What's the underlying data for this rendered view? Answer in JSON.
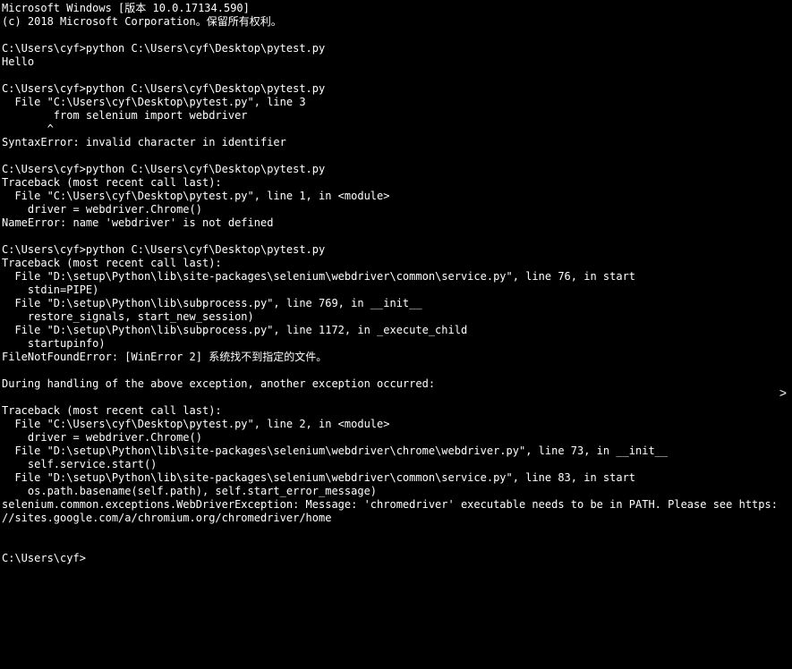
{
  "terminal": {
    "lines": [
      "Microsoft Windows [版本 10.0.17134.590]",
      "(c) 2018 Microsoft Corporation。保留所有权利。",
      "",
      "C:\\Users\\cyf>python C:\\Users\\cyf\\Desktop\\pytest.py",
      "Hello",
      "",
      "C:\\Users\\cyf>python C:\\Users\\cyf\\Desktop\\pytest.py",
      "  File \"C:\\Users\\cyf\\Desktop\\pytest.py\", line 3",
      "        from selenium import webdriver",
      "       ^",
      "SyntaxError: invalid character in identifier",
      "",
      "C:\\Users\\cyf>python C:\\Users\\cyf\\Desktop\\pytest.py",
      "Traceback (most recent call last):",
      "  File \"C:\\Users\\cyf\\Desktop\\pytest.py\", line 1, in <module>",
      "    driver = webdriver.Chrome()",
      "NameError: name 'webdriver' is not defined",
      "",
      "C:\\Users\\cyf>python C:\\Users\\cyf\\Desktop\\pytest.py",
      "Traceback (most recent call last):",
      "  File \"D:\\setup\\Python\\lib\\site-packages\\selenium\\webdriver\\common\\service.py\", line 76, in start",
      "    stdin=PIPE)",
      "  File \"D:\\setup\\Python\\lib\\subprocess.py\", line 769, in __init__",
      "    restore_signals, start_new_session)",
      "  File \"D:\\setup\\Python\\lib\\subprocess.py\", line 1172, in _execute_child",
      "    startupinfo)",
      "FileNotFoundError: [WinError 2] 系统找不到指定的文件。",
      "",
      "During handling of the above exception, another exception occurred:",
      "",
      "Traceback (most recent call last):",
      "  File \"C:\\Users\\cyf\\Desktop\\pytest.py\", line 2, in <module>",
      "    driver = webdriver.Chrome()",
      "  File \"D:\\setup\\Python\\lib\\site-packages\\selenium\\webdriver\\chrome\\webdriver.py\", line 73, in __init__",
      "    self.service.start()",
      "  File \"D:\\setup\\Python\\lib\\site-packages\\selenium\\webdriver\\common\\service.py\", line 83, in start",
      "    os.path.basename(self.path), self.start_error_message)",
      "selenium.common.exceptions.WebDriverException: Message: 'chromedriver' executable needs to be in PATH. Please see https:",
      "//sites.google.com/a/chromium.org/chromedriver/home",
      "",
      "",
      "C:\\Users\\cyf>"
    ]
  },
  "scroll": {
    "arrow": ">"
  }
}
